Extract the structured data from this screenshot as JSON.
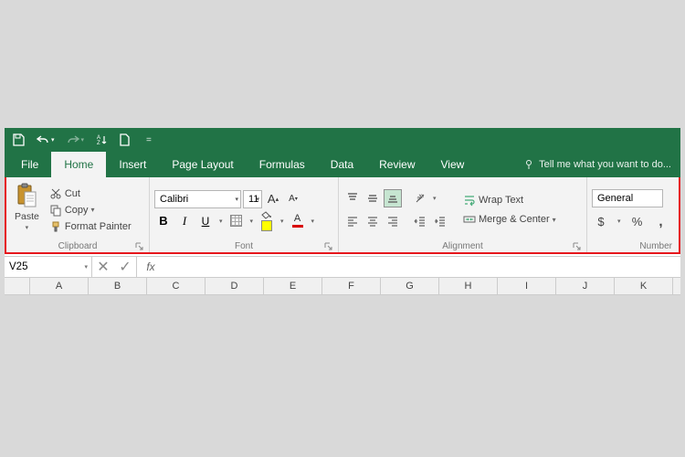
{
  "qat": {
    "items": [
      "save",
      "undo",
      "redo",
      "sort",
      "new"
    ]
  },
  "tabs": {
    "file": "File",
    "list": [
      "Home",
      "Insert",
      "Page Layout",
      "Formulas",
      "Data",
      "Review",
      "View"
    ],
    "active": "Home",
    "tellme": "Tell me what you want to do..."
  },
  "clipboard": {
    "paste": "Paste",
    "cut": "Cut",
    "copy": "Copy",
    "format_painter": "Format Painter",
    "label": "Clipboard"
  },
  "font": {
    "name": "Calibri",
    "size": "11",
    "label": "Font"
  },
  "alignment": {
    "wrap": "Wrap Text",
    "merge": "Merge & Center",
    "label": "Alignment"
  },
  "number": {
    "format": "General",
    "label": "Number"
  },
  "formula_bar": {
    "name_box": "V25",
    "fx": "fx"
  },
  "columns": [
    "A",
    "B",
    "C",
    "D",
    "E",
    "F",
    "G",
    "H",
    "I",
    "J",
    "K"
  ]
}
